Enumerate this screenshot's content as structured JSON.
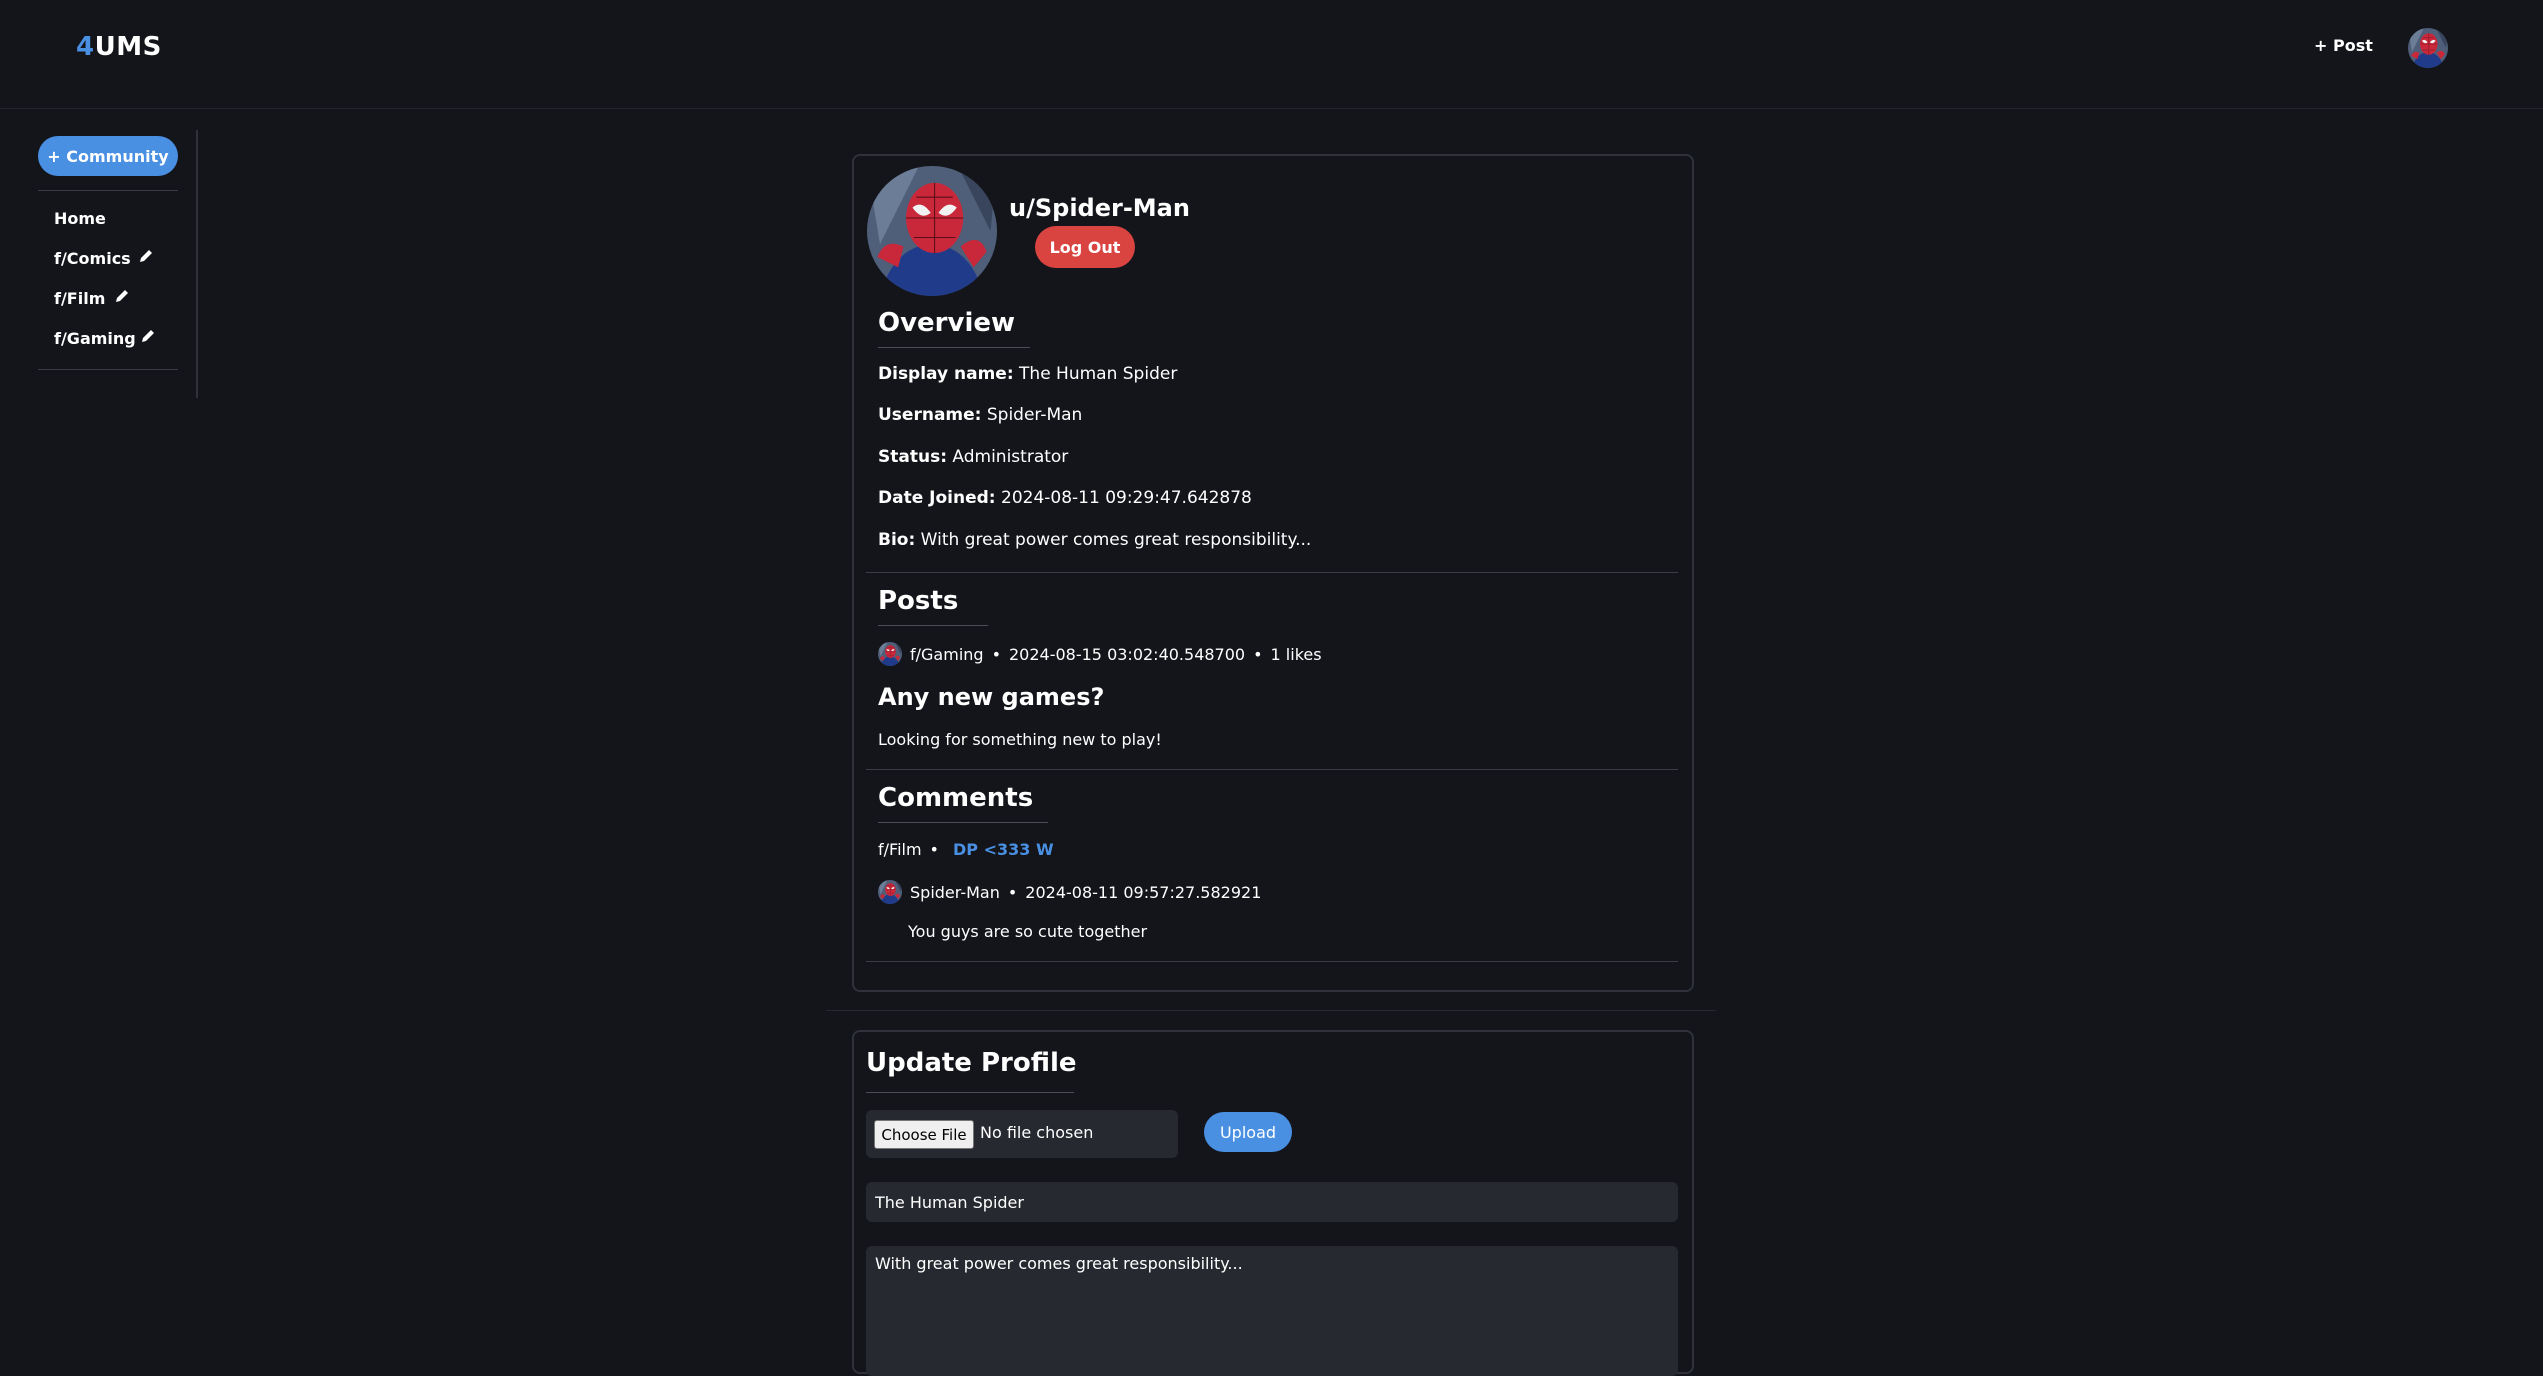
{
  "header": {
    "logo_accent": "4",
    "logo_rest": "UMS",
    "post_label": "+ Post"
  },
  "sidebar": {
    "community_button": "+ Community",
    "items": [
      {
        "label": "Home"
      },
      {
        "label": "f/Comics"
      },
      {
        "label": "f/Film"
      },
      {
        "label": "f/Gaming"
      }
    ]
  },
  "profile": {
    "username": "u/Spider-Man",
    "logout_label": "Log Out",
    "overview_heading": "Overview",
    "fields": [
      {
        "label": "Display name:",
        "value": "The Human Spider"
      },
      {
        "label": "Username:",
        "value": "Spider-Man"
      },
      {
        "label": "Status:",
        "value": "Administrator"
      },
      {
        "label": "Date Joined:",
        "value": "2024-08-11 09:29:47.642878"
      },
      {
        "label": "Bio:",
        "value": "With great power comes great responsibility..."
      }
    ],
    "posts_heading": "Posts",
    "post": {
      "community": "f/Gaming",
      "timestamp": "2024-08-15 03:02:40.548700",
      "likes": "1 likes",
      "title": "Any new games?",
      "body": "Looking for something new to play!"
    },
    "comments_heading": "Comments",
    "comment": {
      "community": "f/Film",
      "post_link": "DP <333 W",
      "author": "Spider-Man",
      "timestamp": "2024-08-11 09:57:27.582921",
      "body": "You guys are so cute together"
    }
  },
  "update": {
    "heading": "Update Profile",
    "choose_file": "Choose File",
    "no_file": "No file chosen",
    "upload_label": "Upload",
    "display_name_value": "The Human Spider",
    "bio_value": "With great power comes great responsibility..."
  },
  "separator": "•",
  "colors": {
    "background": "#13151b",
    "accent": "#4a90e2",
    "danger": "#d94340",
    "input_bg": "#262930"
  }
}
